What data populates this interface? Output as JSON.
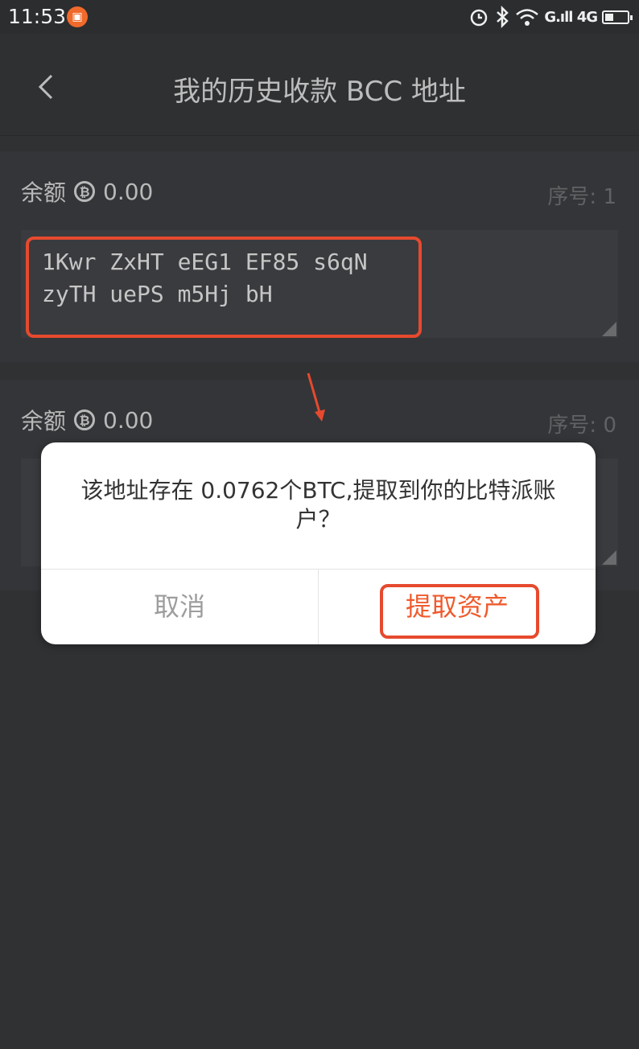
{
  "status_bar": {
    "time": "11:53",
    "network": "G.ıll 4G"
  },
  "header": {
    "title": "我的历史收款 BCC 地址"
  },
  "addresses": [
    {
      "balance_label": "余额",
      "balance": "0.00",
      "serial_label": "序号: 1",
      "address": "1Kwr ZxHT eEG1 EF85 s6qN zyTH uePS m5Hj bH"
    },
    {
      "balance_label": "余额",
      "balance": "0.00",
      "serial_label": "序号: 0",
      "address": ""
    }
  ],
  "dialog": {
    "message": "该地址存在 0.0762个BTC,提取到你的比特派账户？",
    "cancel": "取消",
    "confirm": "提取资产"
  },
  "colors": {
    "accent": "#ef5b2d",
    "annotation": "#e64a2e",
    "background": "#303133"
  },
  "icons": {
    "back": "chevron-left-icon",
    "coin": "bitcoin-icon",
    "alarm": "alarm-icon",
    "bluetooth": "bluetooth-icon",
    "wifi": "wifi-icon",
    "battery": "battery-icon"
  }
}
